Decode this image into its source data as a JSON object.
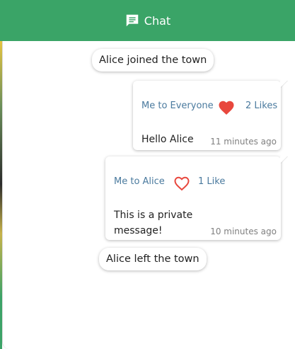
{
  "header": {
    "title": "Chat",
    "icon": "chat-bubble-icon",
    "color": "#3aa467"
  },
  "system_messages": [
    {
      "text": "Alice joined the town"
    },
    {
      "text": "Alice left the town"
    }
  ],
  "messages": [
    {
      "meta": "Me to Everyone",
      "liked": true,
      "likes_label": "2 Likes",
      "text": "Hello Alice",
      "time": "11 minutes ago"
    },
    {
      "meta": "Me to Alice",
      "liked": false,
      "likes_label": "1 Like",
      "text": "This is a private message!",
      "time": "10 minutes ago"
    }
  ],
  "colors": {
    "heart": "#e8473d",
    "meta": "#4a7a9e"
  }
}
